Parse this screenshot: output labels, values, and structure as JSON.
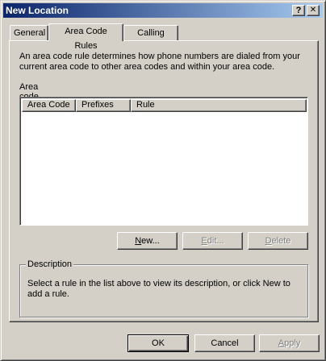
{
  "window": {
    "title": "New Location",
    "help_glyph": "?",
    "close_glyph": "✕"
  },
  "tabs": [
    {
      "label": "General",
      "active": false
    },
    {
      "label": "Area Code Rules",
      "active": true
    },
    {
      "label": "Calling Card",
      "active": false
    }
  ],
  "panel": {
    "intro": "An area code rule determines how phone numbers are dialed from your current area code to other area codes and within your area code.",
    "rules_label_pre": "Area ",
    "rules_label_accel": "c",
    "rules_label_post": "ode rules:",
    "columns": [
      "Area Code",
      "Prefixes",
      "Rule"
    ],
    "rows": [],
    "buttons": {
      "new_accel": "N",
      "new_rest": "ew...",
      "edit_accel": "E",
      "edit_rest": "dit...",
      "delete_accel": "D",
      "delete_rest": "elete"
    },
    "description_legend": "Description",
    "description_text": "Select a rule in the list above to view its description, or click New to add a rule."
  },
  "footer": {
    "ok": "OK",
    "cancel": "Cancel",
    "apply_accel": "A",
    "apply_rest": "pply"
  },
  "colors": {
    "titlebar_start": "#0a246a",
    "titlebar_end": "#a6caf0",
    "face": "#d4d0c8"
  }
}
